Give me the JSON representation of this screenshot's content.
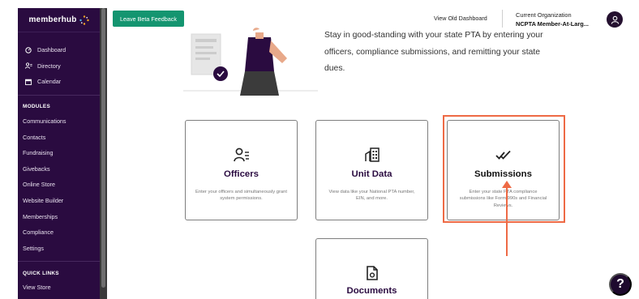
{
  "sidebar": {
    "logo": "memberhub",
    "nav": [
      {
        "label": "Dashboard",
        "icon": "dashboard-icon"
      },
      {
        "label": "Directory",
        "icon": "directory-icon"
      },
      {
        "label": "Calendar",
        "icon": "calendar-icon"
      }
    ],
    "modules_title": "MODULES",
    "modules": [
      "Communications",
      "Contacts",
      "Fundraising",
      "Givebacks",
      "Online Store",
      "Website Builder",
      "Memberships",
      "Compliance",
      "Settings"
    ],
    "quick_links_title": "QUICK LINKS",
    "quick_links": [
      "View Store"
    ]
  },
  "header": {
    "feedback_label": "Leave Beta Feedback",
    "view_old_label": "View Old Dashboard",
    "org_label": "Current Organization",
    "org_name": "NCPTA Member-At-Larg..."
  },
  "hero": {
    "text": "Stay in good-standing with your state PTA by entering your officers, compliance submissions, and remitting your state dues."
  },
  "cards": [
    {
      "key": "officers",
      "title": "Officers",
      "icon": "officers-icon",
      "desc": "Enter your officers and simultaneously grant system permissions."
    },
    {
      "key": "unit",
      "title": "Unit Data",
      "icon": "building-icon",
      "desc": "View data like your National PTA number, EIN, and more."
    },
    {
      "key": "submissions",
      "title": "Submissions",
      "icon": "double-check-icon",
      "desc": "Enter your state PTA compliance submissions like Form 990s and Financial Reviews."
    },
    {
      "key": "documents",
      "title": "Documents",
      "icon": "document-icon",
      "desc": ""
    }
  ],
  "help_label": "?",
  "colors": {
    "sidebar_bg": "#2a0b40",
    "feedback_green": "#149570",
    "highlight": "#ee6a45",
    "title_purple": "#2a0b40"
  }
}
